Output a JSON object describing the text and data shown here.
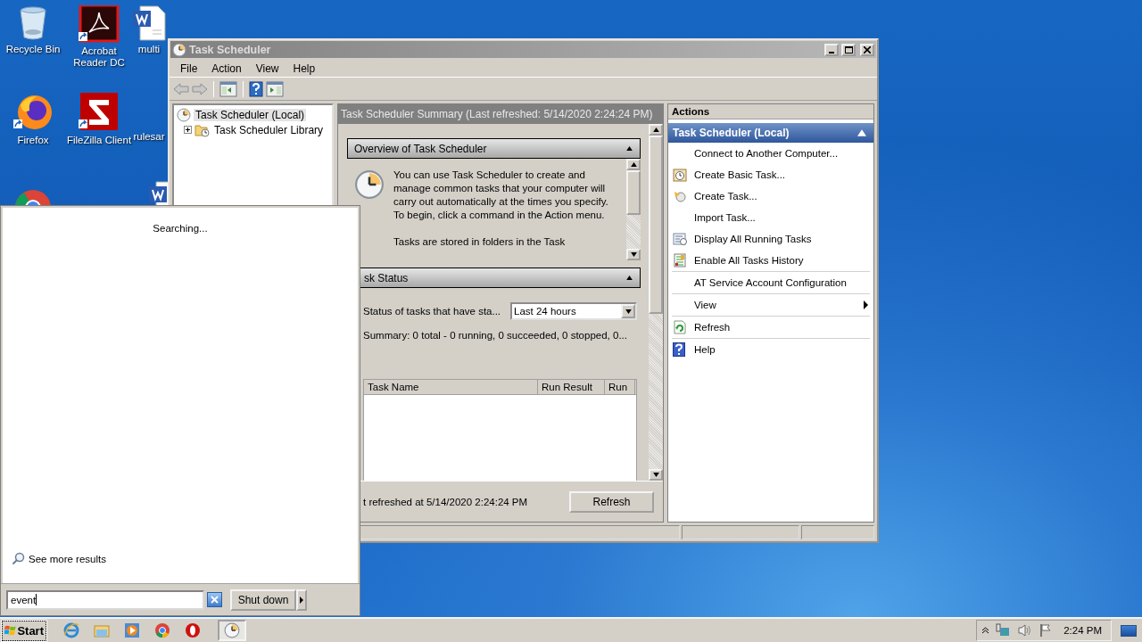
{
  "desktop": {
    "icons": [
      {
        "kind": "recycle",
        "label": "Recycle Bin"
      },
      {
        "kind": "acrobat",
        "label": "Acrobat Reader DC"
      },
      {
        "kind": "word",
        "label": "multi"
      },
      {
        "kind": "firefox",
        "label": "Firefox"
      },
      {
        "kind": "filezilla",
        "label": "FileZilla Client"
      },
      {
        "kind": "blank",
        "label": "rulesar"
      },
      {
        "kind": "chrome"
      },
      {
        "kind": "word"
      }
    ]
  },
  "window": {
    "title": "Task Scheduler",
    "menu": [
      "File",
      "Action",
      "View",
      "Help"
    ],
    "toolbar": [
      {
        "kind": "back",
        "disabled": true
      },
      {
        "kind": "forward",
        "disabled": true
      },
      {
        "kind": "tree",
        "disabled": false
      },
      {
        "kind": "help",
        "disabled": false
      },
      {
        "kind": "actions",
        "disabled": false
      }
    ],
    "tree": [
      {
        "label": "Task Scheduler (Local)",
        "selected": true,
        "children": [
          {
            "label": "Task Scheduler Library",
            "selected": false,
            "expanded": false
          }
        ]
      }
    ],
    "summary": {
      "header": "Task Scheduler Summary (Last refreshed: 5/14/2020 2:24:24 PM)",
      "overview": {
        "title": "Overview of Task Scheduler",
        "expanded": true,
        "paragraphs": [
          "You can use Task Scheduler to create and manage common tasks that your computer will carry out automatically at the times you specify. To begin, click a command in the Action menu.",
          "Tasks are stored in folders in the Task"
        ]
      },
      "task_status": {
        "title": "sk Status",
        "expanded": true,
        "filter_label": "Status of tasks that have sta...",
        "filter_value": "Last 24 hours",
        "summary": "Summary: 0 total - 0 running, 0 succeeded, 0 stopped, 0...",
        "columns": [
          "Task Name",
          "Run Result",
          "Run"
        ]
      },
      "refreshed": "t refreshed at 5/14/2020 2:24:24 PM",
      "refresh_button": "Refresh"
    },
    "actions": {
      "title": "Actions",
      "group": {
        "title": "Task Scheduler (Local)",
        "expanded": true
      },
      "items": [
        {
          "kind": "text",
          "label": "Connect to Another Computer..."
        },
        {
          "kind": "basic-task",
          "label": "Create Basic Task..."
        },
        {
          "kind": "task",
          "label": "Create Task..."
        },
        {
          "kind": "text",
          "label": "Import Task..."
        },
        {
          "kind": "running",
          "label": "Display All Running Tasks"
        },
        {
          "kind": "history",
          "label": "Enable All Tasks History"
        },
        {
          "kind": "separator"
        },
        {
          "kind": "text",
          "label": "AT Service Account Configuration"
        },
        {
          "kind": "separator"
        },
        {
          "kind": "submenu",
          "label": "View"
        },
        {
          "kind": "separator"
        },
        {
          "kind": "refresh",
          "label": "Refresh"
        },
        {
          "kind": "separator"
        },
        {
          "kind": "help",
          "label": "Help"
        }
      ]
    }
  },
  "start_menu": {
    "status": "Searching...",
    "more_results": "See more results",
    "search": {
      "value": "event"
    },
    "shutdown": "Shut down"
  },
  "taskbar": {
    "start": "Start",
    "quick_launch": [
      {
        "kind": "ie"
      },
      {
        "kind": "explorer"
      },
      {
        "kind": "media"
      },
      {
        "kind": "chrome"
      },
      {
        "kind": "opera"
      }
    ],
    "tasks": [
      {
        "kind": "clock",
        "selected": true
      }
    ],
    "time": "2:24 PM"
  }
}
